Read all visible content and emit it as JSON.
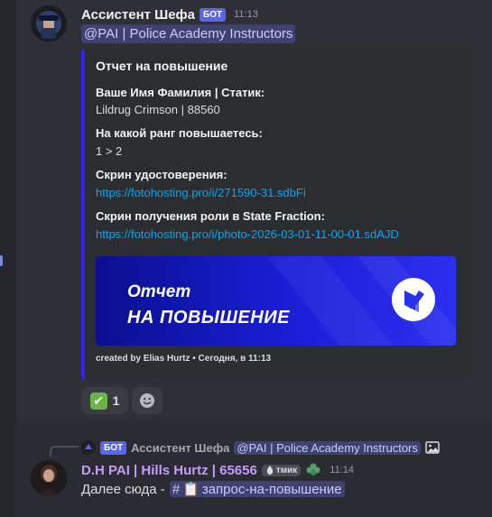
{
  "message1": {
    "author": "Ассистент Шефа",
    "bot_tag": "БОТ",
    "time": "11:13",
    "mention": "@PAI | Police Academy Instructors"
  },
  "embed": {
    "accent_color": "#2f24f0",
    "title": "Отчет на повышение",
    "fields": [
      {
        "name": "Ваше Имя Фамилия | Статик:",
        "value": "Lildrug Crimson | 88560"
      },
      {
        "name": "На какой ранг повышаетесь:",
        "value": "1 > 2"
      },
      {
        "name": "Скрин удостоверения:",
        "value": "https://fotohosting.pro/i/271590-31.sdbFi"
      },
      {
        "name": "Скрин получения роли в State Fraction:",
        "value": "https://fotohosting.pro/i/photo-2026-03-01-11-00-01.sdAJD"
      }
    ],
    "image": {
      "line1": "Отчет",
      "line2": "НА ПОВЫШЕНИЕ",
      "badge_icon": "pen-document-icon"
    },
    "footer": "created by Elias Hurtz • Сегодня, в 11:13"
  },
  "reactions": [
    {
      "emoji": "✔",
      "icon": "check-mark-icon",
      "count": "1"
    },
    {
      "icon": "add-reaction-icon"
    }
  ],
  "reply": {
    "icon": "police-icon",
    "bot_tag": "БОТ",
    "author": "Ассистент Шефа",
    "mention": "@PAI | Police Academy Instructors",
    "attachment_icon": "image-icon"
  },
  "message2": {
    "author": "D.H PAI | Hills Hurtz | 65656",
    "clan_tag": "тмик",
    "badge_icon": "clover-icon",
    "time": "11:14",
    "text": "Далее сюда -",
    "channel_hash": "#",
    "channel_emoji": "📋",
    "channel": "запрос-на-повышение"
  }
}
